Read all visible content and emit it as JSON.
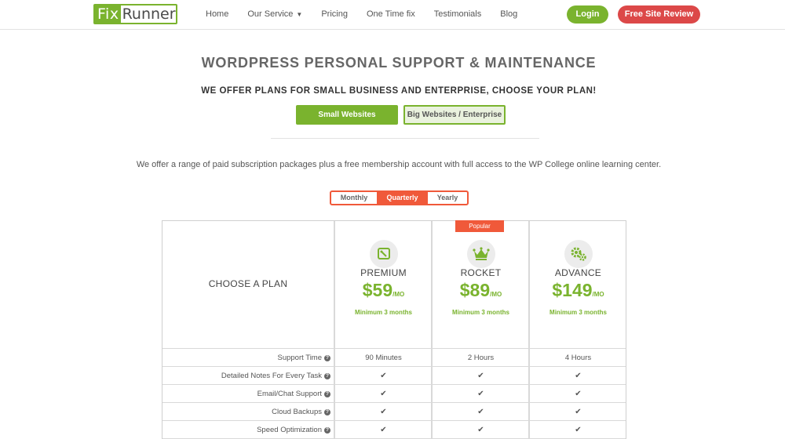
{
  "header": {
    "logo_left": "Fix",
    "logo_right": "Runner",
    "nav": [
      {
        "label": "Home"
      },
      {
        "label": "Our Service",
        "has_dropdown": true
      },
      {
        "label": "Pricing"
      },
      {
        "label": "One Time fix"
      },
      {
        "label": "Testimonials"
      },
      {
        "label": "Blog"
      }
    ],
    "login_label": "Login",
    "review_label": "Free Site Review"
  },
  "hero": {
    "title": "WORDPRESS PERSONAL SUPPORT & MAINTENANCE",
    "subtitle": "WE OFFER PLANS FOR SMALL BUSINESS AND ENTERPRISE, CHOOSE YOUR PLAN!",
    "small_label": "Small Websites",
    "big_label": "Big Websites / Enterprise",
    "intro": "We offer a range of paid subscription packages plus a free membership account with full access to the WP College online learning center."
  },
  "billing": {
    "options": [
      "Monthly",
      "Quarterly",
      "Yearly"
    ],
    "selected": "Quarterly"
  },
  "pricing": {
    "choose_label": "CHOOSE A PLAN",
    "popular_label": "Popular",
    "plans": [
      {
        "name": "PREMIUM",
        "price": "$59",
        "per": "/MO",
        "min": "Minimum 3 months",
        "icon": "tag-icon"
      },
      {
        "name": "ROCKET",
        "price": "$89",
        "per": "/MO",
        "min": "Minimum 3 months",
        "icon": "crown-icon"
      },
      {
        "name": "ADVANCE",
        "price": "$149",
        "per": "/MO",
        "min": "Minimum 3 months",
        "icon": "gears-icon"
      }
    ],
    "rows": [
      {
        "label": "Support Time",
        "values": [
          "90 Minutes",
          "2 Hours",
          "4 Hours"
        ]
      },
      {
        "label": "Detailed Notes For Every Task",
        "values": [
          "✔",
          "✔",
          "✔"
        ]
      },
      {
        "label": "Email/Chat Support",
        "values": [
          "✔",
          "✔",
          "✔"
        ]
      },
      {
        "label": "Cloud Backups",
        "values": [
          "✔",
          "✔",
          "✔"
        ]
      },
      {
        "label": "Speed Optimization",
        "values": [
          "✔",
          "✔",
          "✔"
        ]
      }
    ],
    "colors": {
      "green": "#7ab32e",
      "orange": "#f0593a",
      "red": "#dc4848"
    }
  }
}
